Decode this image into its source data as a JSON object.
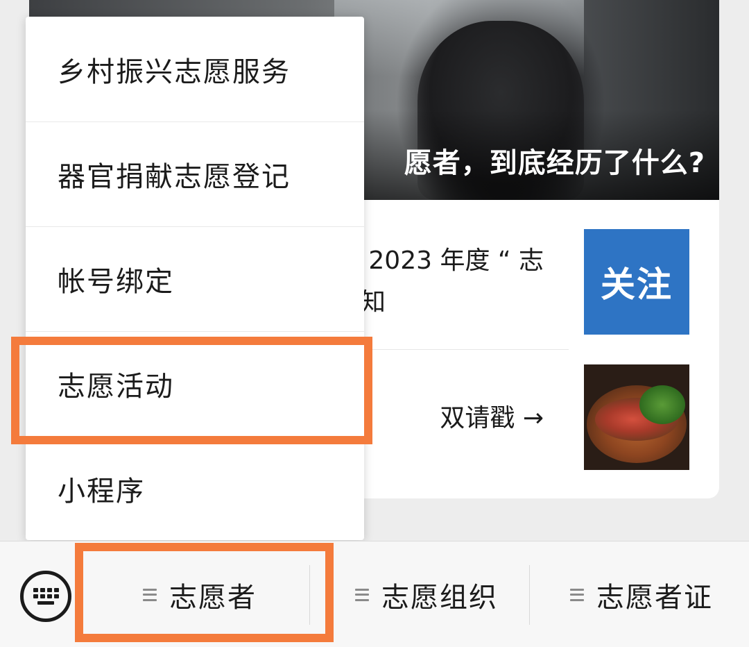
{
  "article": {
    "hero_title": "愿者，到底经历了什么?",
    "news": [
      {
        "line1": "| 2023 年度 “ 志",
        "line2": "知"
      },
      {
        "line1": "双请戳 →",
        "line2": ""
      }
    ],
    "follow_thumb_text": "关注"
  },
  "popup_menu": {
    "items": [
      "乡村振兴志愿服务",
      "器官捐献志愿登记",
      "帐号绑定",
      "志愿活动",
      "小程序"
    ]
  },
  "bottom_bar": {
    "keyboard_icon": "keyboard-icon",
    "tabs": [
      "志愿者",
      "志愿组织",
      "志愿者证"
    ]
  },
  "colors": {
    "highlight": "#f47b3c",
    "follow_thumb": "#2e74c4"
  }
}
